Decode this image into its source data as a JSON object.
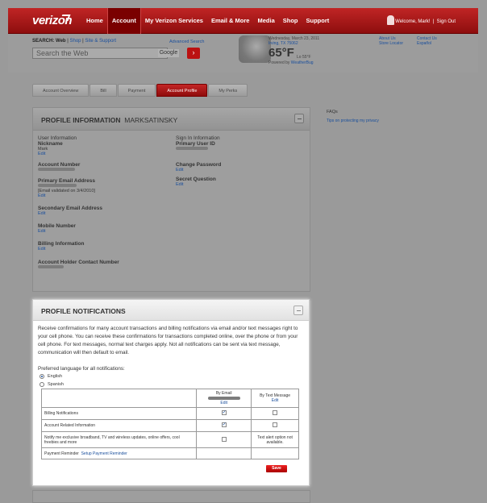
{
  "header": {
    "logo": "verizon",
    "nav": [
      "Home",
      "Account",
      "My Verizon Services",
      "Email & More",
      "Media",
      "Shop",
      "Support"
    ],
    "active_nav": "Account",
    "welcome": "Welcome, Mark!",
    "sign_out": "Sign Out"
  },
  "search": {
    "label": "SEARCH:",
    "scope_web": "Web",
    "scope_shop": "Shop",
    "scope_site": "Site & Support",
    "advanced": "Advanced Search",
    "placeholder": "Search the Web",
    "powered_by": "Google"
  },
  "weather": {
    "date": "Wednesday, March 23, 2011",
    "location": "Irving, TX 75062",
    "temp": "65°F",
    "lo": "Lo 55°F",
    "powered_label": "Powered by",
    "powered_brand": "WeatherBug"
  },
  "util_links": {
    "about": "About Us",
    "store": "Store Locator",
    "contact": "Contact Us",
    "espanol": "Español"
  },
  "tabs": [
    "Account Overview",
    "Bill",
    "Payment",
    "Account Profile",
    "My Perks"
  ],
  "active_tab": "Account Profile",
  "profile": {
    "title": "PROFILE INFORMATION",
    "username": "MARKSATINSKY",
    "user_info": "User Information",
    "nickname_label": "Nickname",
    "nickname_value": "Mark",
    "edit": "Edit",
    "account_number_label": "Account Number",
    "primary_email_label": "Primary Email Address",
    "email_validated": "[Email validated on 3/4/2010]",
    "secondary_email_label": "Secondary Email Address",
    "mobile_label": "Mobile Number",
    "billing_label": "Billing Information",
    "holder_label": "Account Holder Contact Number",
    "sign_in_info": "Sign In Information",
    "primary_user_id_label": "Primary User ID",
    "change_password_label": "Change Password",
    "secret_question_label": "Secret Question"
  },
  "notifications": {
    "title": "PROFILE NOTIFICATIONS",
    "description": "Receive confirmations for many account transactions and billing notifications via email and/or text messages right to your cell phone. You can receive these confirmations for transactions completed online, over the phone or from your cell phone. For text messages, normal text charges apply. Not all notifications can be sent via text message, communication will then default to email.",
    "pref_label": "Preferred language for all notifications:",
    "lang_english": "English",
    "lang_spanish": "Spanish",
    "col_email": "By Email",
    "col_text": "By Text Message",
    "edit": "Edit",
    "rows": [
      {
        "label": "Billing Notifications",
        "email": true,
        "text": false
      },
      {
        "label": "Account Related Information",
        "email": true,
        "text": false
      },
      {
        "label": "Notify me exclusive broadband, TV and wireless updates, online offers,  cool freebies and more",
        "email": false,
        "text_note": "Text alert option not available."
      },
      {
        "label": "Payment Reminder",
        "link": "Setup Payment Reminder"
      }
    ],
    "save": "Save"
  },
  "sidebar": {
    "faqs": "FAQs",
    "faq_link": "Tips on protecting my privacy"
  }
}
